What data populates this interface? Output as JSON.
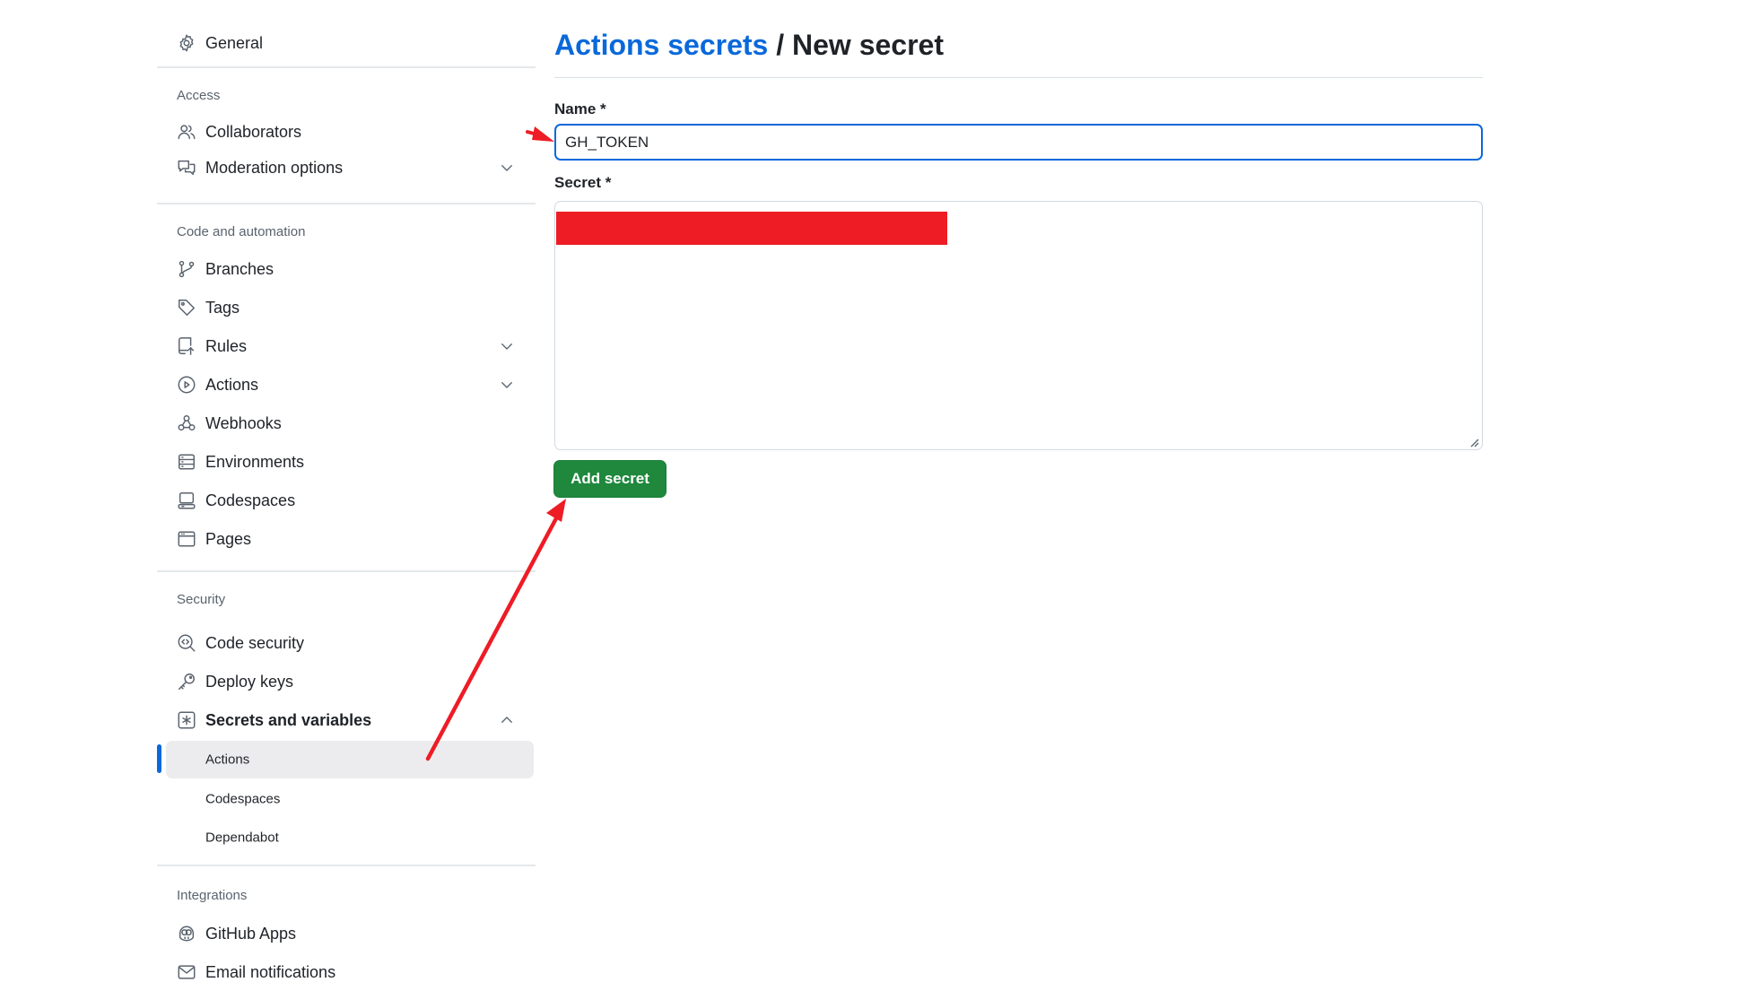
{
  "sidebar": {
    "general": {
      "label": "General",
      "icon": "gear-icon"
    },
    "sections": {
      "access": {
        "heading": "Access",
        "items": [
          {
            "label": "Collaborators",
            "icon": "people-icon"
          },
          {
            "label": "Moderation options",
            "icon": "comment-discussion-icon",
            "expandable": true
          }
        ]
      },
      "code_automation": {
        "heading": "Code and automation",
        "items": [
          {
            "label": "Branches",
            "icon": "git-branch-icon"
          },
          {
            "label": "Tags",
            "icon": "tag-icon"
          },
          {
            "label": "Rules",
            "icon": "repo-push-icon",
            "expandable": true
          },
          {
            "label": "Actions",
            "icon": "play-icon",
            "expandable": true
          },
          {
            "label": "Webhooks",
            "icon": "webhook-icon"
          },
          {
            "label": "Environments",
            "icon": "server-icon"
          },
          {
            "label": "Codespaces",
            "icon": "codespaces-icon"
          },
          {
            "label": "Pages",
            "icon": "browser-icon"
          }
        ]
      },
      "security": {
        "heading": "Security",
        "items": [
          {
            "label": "Code security",
            "icon": "codescan-icon"
          },
          {
            "label": "Deploy keys",
            "icon": "key-icon"
          },
          {
            "label": "Secrets and variables",
            "icon": "asterisk-box-icon",
            "expanded": true
          }
        ],
        "subitems": [
          {
            "label": "Actions",
            "active": true
          },
          {
            "label": "Codespaces"
          },
          {
            "label": "Dependabot"
          }
        ]
      },
      "integrations": {
        "heading": "Integrations",
        "items": [
          {
            "label": "GitHub Apps",
            "icon": "copilot-icon"
          },
          {
            "label": "Email notifications",
            "icon": "mail-icon"
          }
        ]
      }
    }
  },
  "main": {
    "breadcrumb_link": "Actions secrets",
    "breadcrumb_sep": "/",
    "breadcrumb_current": "New secret",
    "name_label": "Name *",
    "name_value": "GH_TOKEN",
    "secret_label": "Secret *",
    "submit_label": "Add secret"
  },
  "colors": {
    "link": "#0969da",
    "primary_button": "#1f883d",
    "annotation_red": "#ee1c25",
    "active_indicator": "#0969da"
  }
}
